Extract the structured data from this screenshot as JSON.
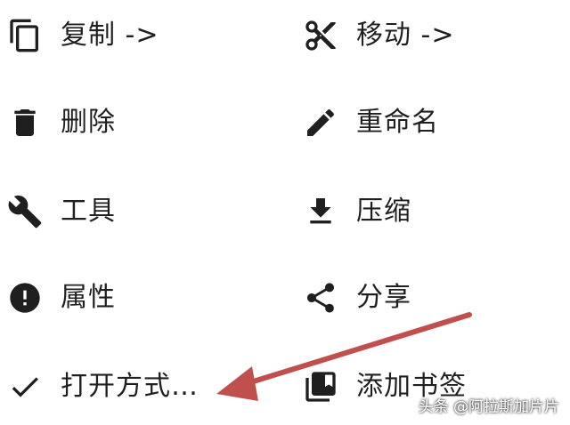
{
  "menu": {
    "items": [
      {
        "label": "复制 ->",
        "icon": "copy-icon"
      },
      {
        "label": "移动 ->",
        "icon": "cut-icon"
      },
      {
        "label": "删除",
        "icon": "delete-icon"
      },
      {
        "label": "重命名",
        "icon": "edit-pencil-icon"
      },
      {
        "label": "工具",
        "icon": "wrench-icon"
      },
      {
        "label": "压缩",
        "icon": "download-icon"
      },
      {
        "label": "属性",
        "icon": "info-alert-icon"
      },
      {
        "label": "分享",
        "icon": "share-icon"
      },
      {
        "label": "打开方式…",
        "icon": "check-icon"
      },
      {
        "label": "添加书签",
        "icon": "bookmark-library-icon"
      }
    ]
  },
  "annotation": {
    "color": "#c0504d"
  },
  "watermark": {
    "text": "头条 @阿拉斯加片片"
  }
}
